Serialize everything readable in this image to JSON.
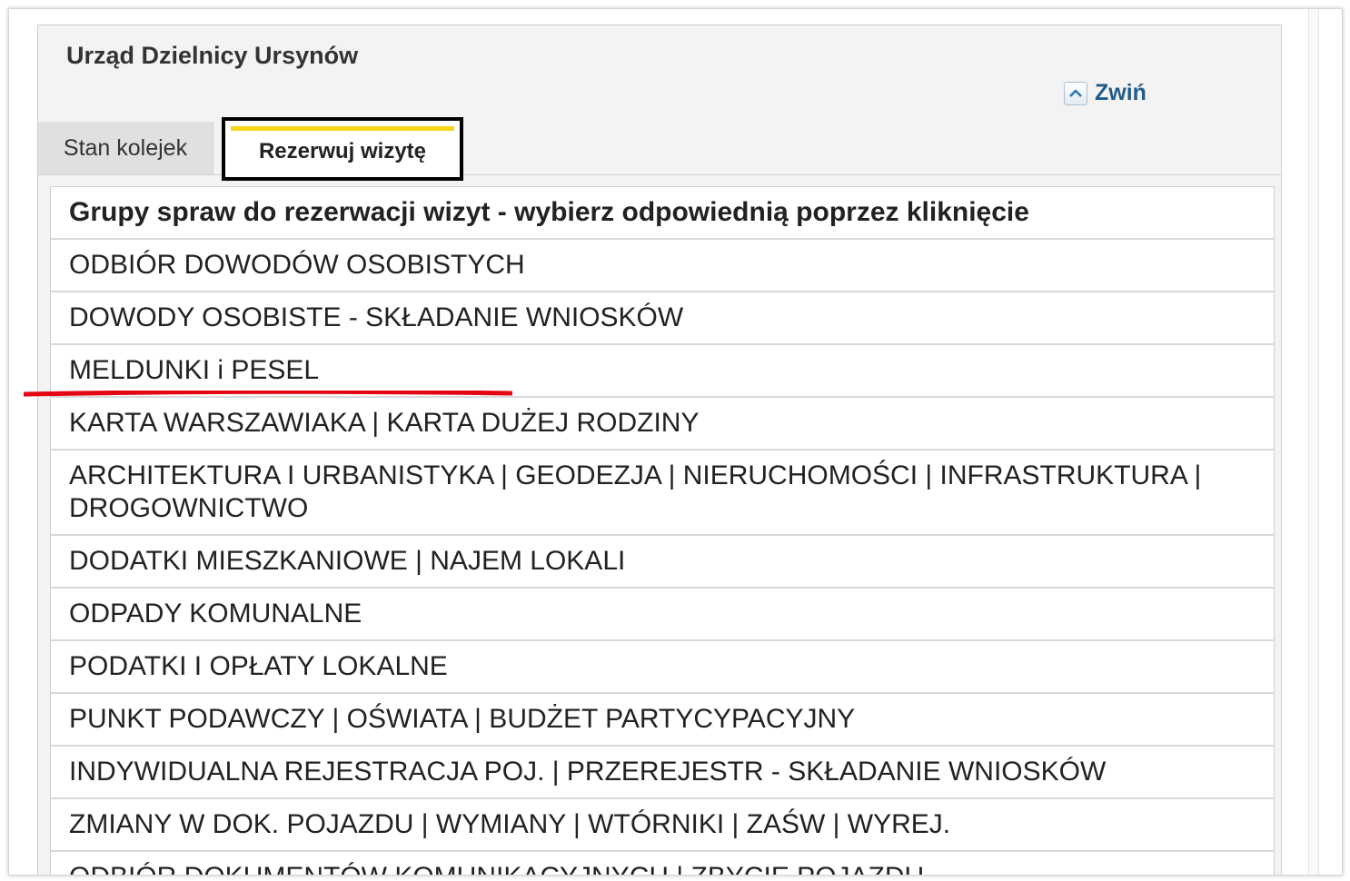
{
  "panel": {
    "title": "Urząd Dzielnicy Ursynów",
    "collapse_label": "Zwiń",
    "collapse_icon": "chevron-up-icon"
  },
  "tabs": [
    {
      "label": "Stan kolejek",
      "active": false
    },
    {
      "label": "Rezerwuj wizytę",
      "active": true
    }
  ],
  "groups_table": {
    "header": "Grupy spraw do rezerwacji wizyt - wybierz odpowiednią poprzez kliknięcie",
    "items": [
      "ODBIÓR DOWODÓW OSOBISTYCH",
      "DOWODY OSOBISTE - SKŁADANIE WNIOSKÓW",
      "MELDUNKI i PESEL",
      "KARTA WARSZAWIAKA | KARTA DUŻEJ RODZINY",
      "ARCHITEKTURA I URBANISTYKA | GEODEZJA | NIERUCHOMOŚCI | INFRASTRUKTURA | DROGOWNICTWO",
      "DODATKI MIESZKANIOWE | NAJEM LOKALI",
      "ODPADY KOMUNALNE",
      "PODATKI I OPŁATY LOKALNE",
      "PUNKT PODAWCZY | OŚWIATA | BUDŻET PARTYCYPACYJNY",
      "INDYWIDUALNA REJESTRACJA POJ. | PRZEREJESTR - SKŁADANIE WNIOSKÓW",
      "ZMIANY W DOK. POJAZDU | WYMIANY | WTÓRNIKI | ZAŚW | WYREJ.",
      "ODBIÓR DOKUMENTÓW KOMUNIKACYJNYCH | ZBYCIE POJAZDU"
    ]
  },
  "colors": {
    "tab_accent": "#f7d417",
    "annotation_underline": "#e30613",
    "link": "#1f5b8a"
  }
}
